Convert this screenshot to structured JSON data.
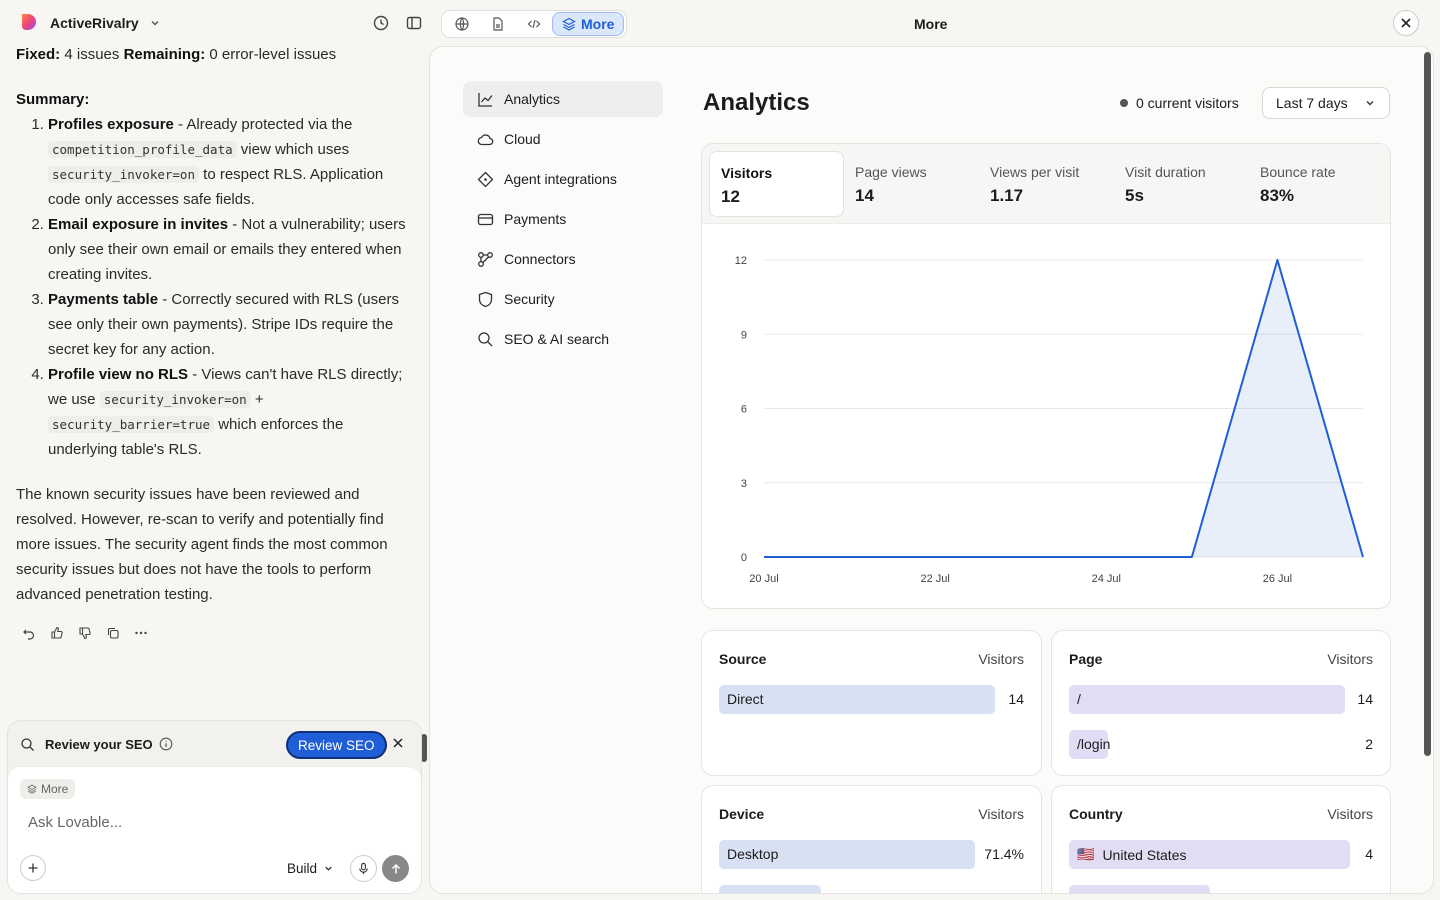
{
  "topbar": {
    "project_name": "ActiveRivalry",
    "more_label": "More",
    "panel_title": "More"
  },
  "chat": {
    "line0_bold1": "Fixed:",
    "line0_text1": " 4 issues ",
    "line0_bold2": "Remaining:",
    "line0_text2": " 0 error-level issues",
    "summary": "Summary:",
    "items": [
      {
        "title": "Profiles exposure",
        "a": " - Already protected via the ",
        "c1": "competition_profile_data",
        "b": " view which uses ",
        "c2": "security_invoker=on",
        "d": " to respect RLS. Application code only accesses safe fields."
      },
      {
        "title": "Email exposure in invites",
        "a": " - Not a vulnerability; users only see their own email or emails they entered when creating invites."
      },
      {
        "title": "Payments table",
        "a": " - Correctly secured with RLS (users see only their own payments). Stripe IDs require the secret key for any action."
      },
      {
        "title": "Profile view no RLS",
        "a": " - Views can't have RLS directly; we use ",
        "c1": "security_invoker=on",
        "b": " + ",
        "c2": "security_barrier=true",
        "d": " which enforces the underlying table's RLS."
      }
    ],
    "closing": "The known security issues have been reviewed and resolved. However, re-scan to verify and potentially find more issues. The security agent finds the most common security issues but does not have the tools to perform advanced penetration testing."
  },
  "composer": {
    "seo_label": "Review your SEO",
    "seo_button": "Review SEO",
    "chip": "More",
    "placeholder": "Ask Lovable...",
    "mode": "Build"
  },
  "nav": [
    {
      "label": "Analytics",
      "icon": "chart-line-icon"
    },
    {
      "label": "Cloud",
      "icon": "cloud-icon"
    },
    {
      "label": "Agent integrations",
      "icon": "diamond-icon"
    },
    {
      "label": "Payments",
      "icon": "credit-card-icon"
    },
    {
      "label": "Connectors",
      "icon": "connectors-icon"
    },
    {
      "label": "Security",
      "icon": "shield-icon"
    },
    {
      "label": "SEO & AI search",
      "icon": "search-icon"
    }
  ],
  "analytics": {
    "title": "Analytics",
    "current_visitors": "0 current visitors",
    "range": "Last 7 days",
    "stats": [
      {
        "label": "Visitors",
        "value": "12"
      },
      {
        "label": "Page views",
        "value": "14"
      },
      {
        "label": "Views per visit",
        "value": "1.17"
      },
      {
        "label": "Visit duration",
        "value": "5s"
      },
      {
        "label": "Bounce rate",
        "value": "83%"
      }
    ]
  },
  "chart_data": {
    "type": "area",
    "x": [
      "20 Jul",
      "21 Jul",
      "22 Jul",
      "23 Jul",
      "24 Jul",
      "25 Jul",
      "26 Jul",
      "27 Jul"
    ],
    "x_ticks": [
      "20 Jul",
      "22 Jul",
      "24 Jul",
      "26 Jul"
    ],
    "y_ticks": [
      0,
      3,
      6,
      9,
      12
    ],
    "series": [
      {
        "values": [
          0,
          0,
          0,
          0,
          0,
          0,
          12,
          0
        ]
      }
    ],
    "ylim": [
      0,
      12
    ],
    "grid": true,
    "color": "#1f5ed6"
  },
  "tables": {
    "source": {
      "title": "Source",
      "col": "Visitors",
      "rows": [
        {
          "label": "Direct",
          "value": "14",
          "frac": 1
        }
      ]
    },
    "page": {
      "title": "Page",
      "col": "Visitors",
      "rows": [
        {
          "label": "/",
          "value": "14",
          "frac": 1
        },
        {
          "label": "/login",
          "value": "2",
          "frac": 0.14
        }
      ]
    },
    "device": {
      "title": "Device",
      "col": "Visitors",
      "rows": [
        {
          "label": "Desktop",
          "value": "71.4%",
          "frac": 1
        },
        {
          "label": "",
          "value": "",
          "frac": 0.4
        }
      ]
    },
    "country": {
      "title": "Country",
      "col": "Visitors",
      "rows": [
        {
          "label": "United States",
          "value": "4",
          "frac": 1,
          "flag": "🇺🇸"
        },
        {
          "label": "",
          "value": "",
          "frac": 0.5
        }
      ]
    }
  }
}
